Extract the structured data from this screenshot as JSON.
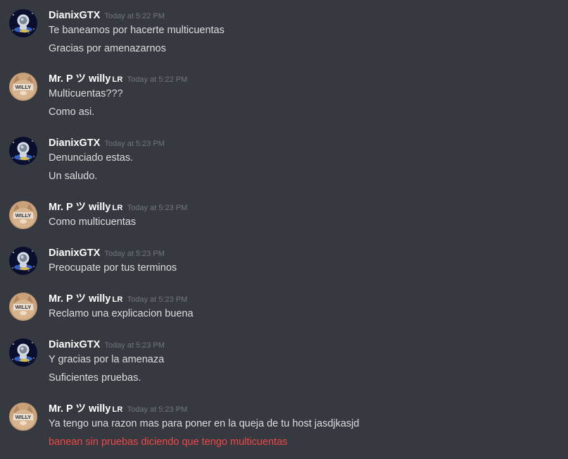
{
  "users": {
    "dianix": {
      "name": "DianixGTX",
      "avatar_icon": "astronaut-avatar-icon"
    },
    "willy": {
      "name": "Mr. P ツ willy",
      "badge": "LR",
      "avatar_icon": "cat-willy-avatar-icon",
      "avatar_text": "WILLY"
    }
  },
  "messages": [
    {
      "user": "DianixGTX",
      "time": "Today at 5:22 PM",
      "lines": [
        "Te baneamos por hacerte multicuentas",
        "Gracias por amenazarnos"
      ]
    },
    {
      "user": "Mr. P ツ willy",
      "badge": "LR",
      "time": "Today at 5:22 PM",
      "lines": [
        "Multicuentas???",
        "Como asi."
      ]
    },
    {
      "user": "DianixGTX",
      "time": "Today at 5:23 PM",
      "lines": [
        "Denunciado estas.",
        "Un saludo."
      ]
    },
    {
      "user": "Mr. P ツ willy",
      "badge": "LR",
      "time": "Today at 5:23 PM",
      "lines": [
        "Como multicuentas"
      ]
    },
    {
      "user": "DianixGTX",
      "time": "Today at 5:23 PM",
      "lines": [
        "Preocupate por tus terminos"
      ]
    },
    {
      "user": "Mr. P ツ willy",
      "badge": "LR",
      "time": "Today at 5:23 PM",
      "lines": [
        "Reclamo una explicacion buena"
      ]
    },
    {
      "user": "DianixGTX",
      "time": "Today at 5:23 PM",
      "lines": [
        "Y gracias por la amenaza",
        "Suficientes pruebas."
      ]
    },
    {
      "user": "Mr. P ツ willy",
      "badge": "LR",
      "time": "Today at 5:23 PM",
      "lines": [
        "Ya tengo una razon mas para poner en la queja de tu host jasdjkasjd",
        "banean sin pruebas diciendo que tengo multicuentas"
      ]
    }
  ],
  "colors": {
    "background": "#36393f",
    "username": "#ffffff",
    "message": "#dcddde",
    "timestamp": "#72767d",
    "highlight_red": "#f04747"
  }
}
